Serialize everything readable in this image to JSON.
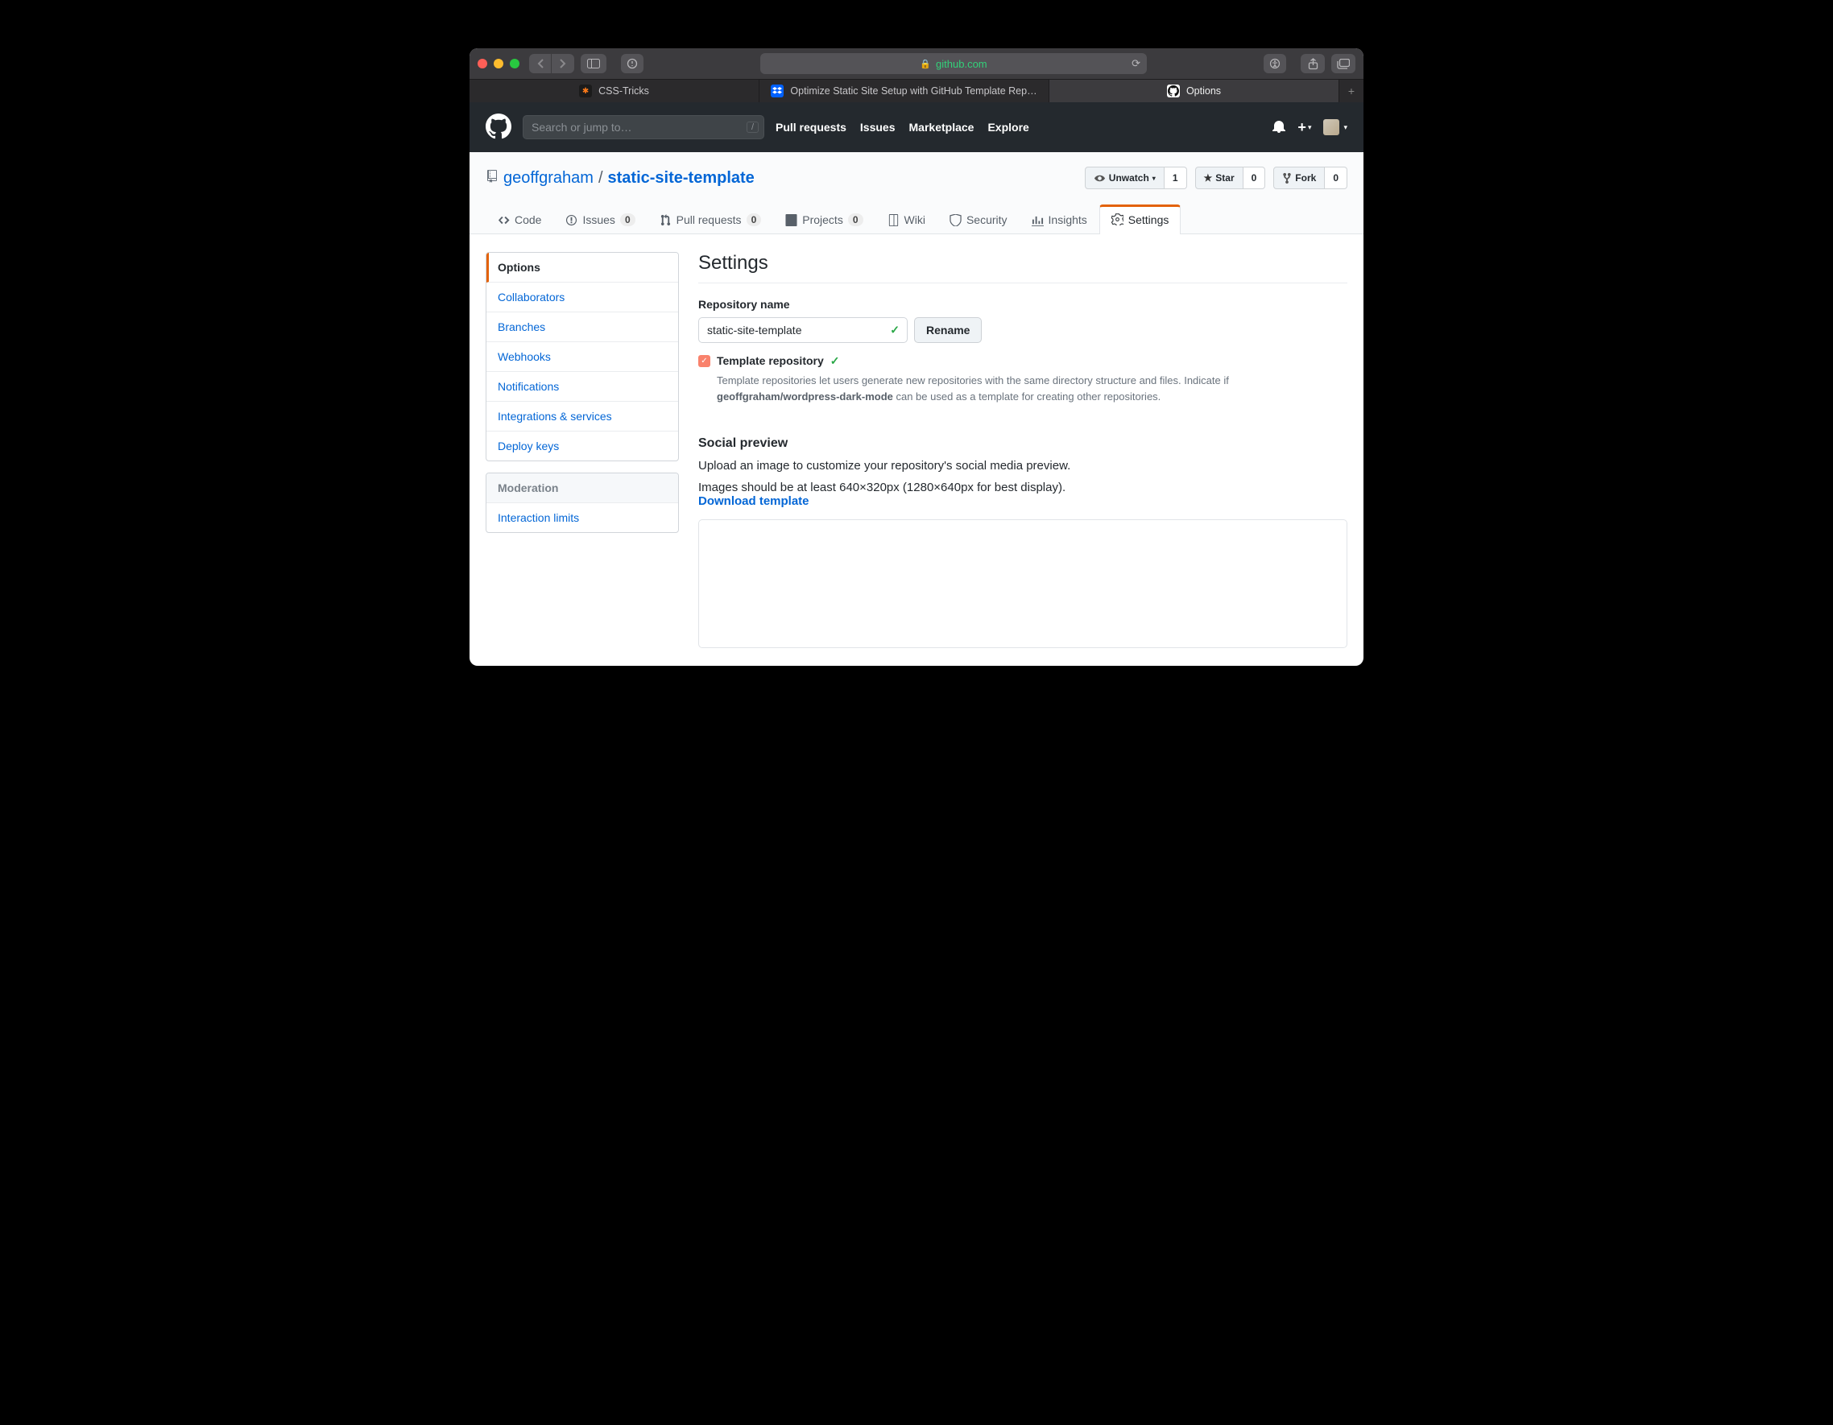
{
  "browser": {
    "url_host": "github.com",
    "tabs": [
      {
        "label": "CSS-Tricks",
        "favicon_bg": "#1b1b1b",
        "favicon_char": "✱",
        "favicon_color": "#ff7a18"
      },
      {
        "label": "Optimize Static Site Setup with GitHub Template Rep…",
        "favicon_bg": "#0061ff",
        "favicon_char": "⧉",
        "favicon_color": "#fff"
      },
      {
        "label": "Options",
        "favicon_bg": "#fff",
        "favicon_char": "",
        "favicon_color": "#111"
      }
    ]
  },
  "gh": {
    "search_placeholder": "Search or jump to…",
    "nav": [
      "Pull requests",
      "Issues",
      "Marketplace",
      "Explore"
    ]
  },
  "repo": {
    "owner": "geoffgraham",
    "name": "static-site-template",
    "watch": {
      "label": "Unwatch",
      "count": "1"
    },
    "star": {
      "label": "Star",
      "count": "0"
    },
    "fork": {
      "label": "Fork",
      "count": "0"
    }
  },
  "tabs": {
    "code": "Code",
    "issues": {
      "label": "Issues",
      "count": "0"
    },
    "pulls": {
      "label": "Pull requests",
      "count": "0"
    },
    "projects": {
      "label": "Projects",
      "count": "0"
    },
    "wiki": "Wiki",
    "security": "Security",
    "insights": "Insights",
    "settings": "Settings"
  },
  "sidebar": {
    "items": [
      "Options",
      "Collaborators",
      "Branches",
      "Webhooks",
      "Notifications",
      "Integrations & services",
      "Deploy keys"
    ],
    "mod_heading": "Moderation",
    "mod_items": [
      "Interaction limits"
    ]
  },
  "settings": {
    "title": "Settings",
    "repo_name_label": "Repository name",
    "repo_name_value": "static-site-template",
    "rename_btn": "Rename",
    "template_label": "Template repository",
    "template_note_pre": "Template repositories let users generate new repositories with the same directory structure and files. Indicate if ",
    "template_note_bold": "geoffgraham/wordpress-dark-mode",
    "template_note_post": " can be used as a template for creating other repositories.",
    "social_heading": "Social preview",
    "social_p1": "Upload an image to customize your repository's social media preview.",
    "social_p2": "Images should be at least 640×320px (1280×640px for best display).",
    "download_link": "Download template"
  }
}
